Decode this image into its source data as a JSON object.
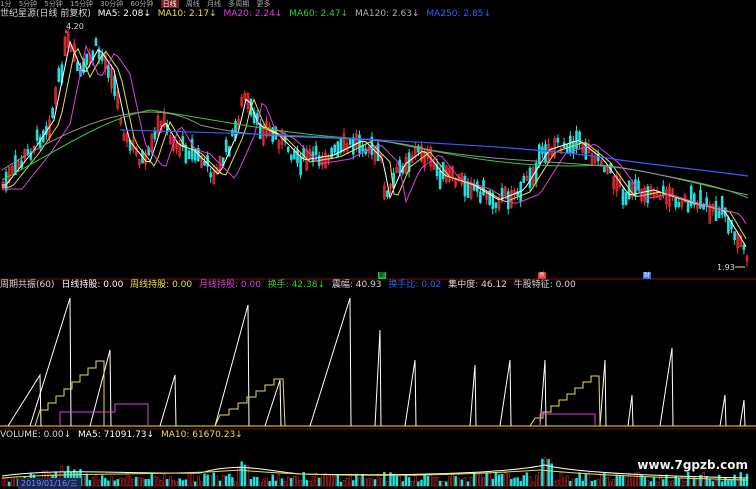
{
  "toolbar": {
    "items": [
      "1分",
      "5分钟",
      "5分钟",
      "15分钟",
      "30分钟",
      "60分钟",
      "日线",
      "周线",
      "月线",
      "多周期",
      "更多"
    ],
    "active_index": 6
  },
  "price_legend": {
    "title": "世纪星源(日线 前复权)",
    "ma5": "MA5: 2.08↓",
    "ma10": "MA10: 2.17↓",
    "ma20": "MA20: 2.24↓",
    "ma60": "MA60: 2.47↓",
    "ma120": "MA120: 2.63↓",
    "ma250": "MA250: 2.85↓",
    "high_label": "4.20",
    "low_label": "1.93",
    "colors": {
      "ma5": "#ffffff",
      "ma10": "#e8e04a",
      "ma20": "#e040e0",
      "ma60": "#30d030",
      "ma120": "#a0a0a0",
      "ma250": "#3060ff"
    }
  },
  "indicator_legend": {
    "name": "周期共振(60)",
    "daily": "日线持股: 0.00",
    "weekly": "周线持股: 0.00",
    "monthly": "月线持股: 0.00",
    "turnover": "换手: 42.38↓",
    "amplitude": "震幅: 40.93",
    "ratio": "换手比: 0.02",
    "concentration": "集中度: 46.12",
    "bull": "牛股特征: 0.00"
  },
  "volume_legend": {
    "volume": "VOLUME: 0.00↓",
    "ma5": "MA5: 71091.73↓",
    "ma10": "MA10: 61670.23↓"
  },
  "markers": [
    {
      "text": "鹏",
      "color": "#20c040"
    },
    {
      "text": "杀",
      "color": "#e03030"
    },
    {
      "text": "财",
      "color": "#3070ff"
    }
  ],
  "date_label": "2019/01/16/三",
  "watermark": "www.7gpzb.com"
}
